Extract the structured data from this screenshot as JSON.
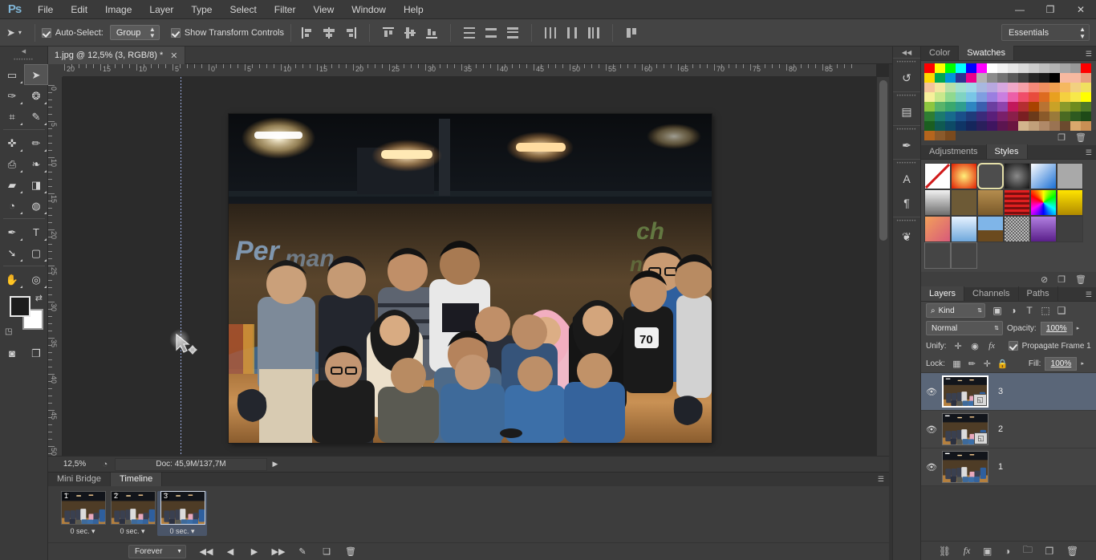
{
  "app": {
    "logo": "Ps",
    "workspace": "Essentials"
  },
  "menubar": {
    "items": [
      "File",
      "Edit",
      "Image",
      "Layer",
      "Type",
      "Select",
      "Filter",
      "View",
      "Window",
      "Help"
    ]
  },
  "window_controls": {
    "minimize": "—",
    "restore": "❐",
    "close": "✕"
  },
  "options_bar": {
    "tool_icon": "move-tool",
    "tool_glyph": "➤",
    "autoselect_label": "Auto-Select:",
    "autoselect_checked": true,
    "group_value": "Group",
    "show_transform_label": "Show Transform Controls",
    "show_transform_checked": true,
    "align_icons": [
      "align-left-edges",
      "align-horizontal-centers",
      "align-right-edges",
      "align-top-edges",
      "align-vertical-centers",
      "align-bottom-edges",
      "distribute-top-edges",
      "distribute-vertical-centers",
      "distribute-bottom-edges",
      "distribute-left-edges",
      "distribute-horizontal-centers",
      "distribute-right-edges",
      "auto-align-layers"
    ]
  },
  "toolbar": {
    "tools": [
      {
        "name": "rectangular-marquee-tool",
        "glyph": "▭",
        "active": false,
        "hasflyout": true
      },
      {
        "name": "move-tool",
        "glyph": "➤",
        "active": true,
        "hasflyout": false
      },
      {
        "name": "lasso-tool",
        "glyph": "✑",
        "active": false,
        "hasflyout": true
      },
      {
        "name": "quick-selection-tool",
        "glyph": "❂",
        "active": false,
        "hasflyout": true
      },
      {
        "name": "crop-tool",
        "glyph": "⌗",
        "active": false,
        "hasflyout": true
      },
      {
        "name": "eyedropper-tool",
        "glyph": "✎",
        "active": false,
        "hasflyout": true
      },
      {
        "name": "spot-healing-brush-tool",
        "glyph": "✜",
        "active": false,
        "hasflyout": true
      },
      {
        "name": "brush-tool",
        "glyph": "✏",
        "active": false,
        "hasflyout": true
      },
      {
        "name": "clone-stamp-tool",
        "glyph": "⎙",
        "active": false,
        "hasflyout": true
      },
      {
        "name": "history-brush-tool",
        "glyph": "❧",
        "active": false,
        "hasflyout": true
      },
      {
        "name": "eraser-tool",
        "glyph": "▰",
        "active": false,
        "hasflyout": true
      },
      {
        "name": "gradient-tool",
        "glyph": "◨",
        "active": false,
        "hasflyout": true
      },
      {
        "name": "blur-tool",
        "glyph": "◔",
        "active": false,
        "hasflyout": true
      },
      {
        "name": "dodge-tool",
        "glyph": "◍",
        "active": false,
        "hasflyout": true
      },
      {
        "name": "pen-tool",
        "glyph": "✒",
        "active": false,
        "hasflyout": true
      },
      {
        "name": "horizontal-type-tool",
        "glyph": "T",
        "active": false,
        "hasflyout": true
      },
      {
        "name": "path-selection-tool",
        "glyph": "➘",
        "active": false,
        "hasflyout": true
      },
      {
        "name": "rectangle-tool",
        "glyph": "▢",
        "active": false,
        "hasflyout": true
      },
      {
        "name": "hand-tool",
        "glyph": "✋",
        "active": false,
        "hasflyout": true
      },
      {
        "name": "zoom-tool",
        "glyph": "◎",
        "active": false,
        "hasflyout": true
      }
    ],
    "foreground_color": "#1c1c1c",
    "background_color": "#ffffff",
    "swap_icon": "swap-colors-icon",
    "reset_icon": "reset-colors-icon",
    "quickmask_icon": "quick-mask-icon",
    "screenmode_icon": "screen-mode-icon"
  },
  "document": {
    "tab_title": "1.jpg @ 12,5% (3, RGB/8) *",
    "close_label": "✕"
  },
  "rulers": {
    "horizontal_labels": [
      "20",
      "15",
      "10",
      "5",
      "0",
      "5",
      "10",
      "15",
      "20",
      "25",
      "30",
      "35",
      "40",
      "45",
      "50",
      "55",
      "60",
      "65",
      "70",
      "75",
      "80",
      "85"
    ],
    "vertical_labels": [
      "0",
      "5",
      "10",
      "15",
      "20",
      "25",
      "30",
      "35",
      "40",
      "45",
      "50"
    ],
    "unit": "cm"
  },
  "status_bar": {
    "zoom": "12,5%",
    "thumb_icon": "document-thumb-icon",
    "doc_info": "Doc: 45,9M/137,7M",
    "arrow": "▶"
  },
  "timeline": {
    "tabs": [
      {
        "label": "Mini Bridge",
        "active": false
      },
      {
        "label": "Timeline",
        "active": true
      }
    ],
    "menu_icon": "panel-menu-icon",
    "frames": [
      {
        "number": "1",
        "delay": "0 sec.",
        "selected": false
      },
      {
        "number": "2",
        "delay": "0 sec.",
        "selected": false
      },
      {
        "number": "3",
        "delay": "0 sec.",
        "selected": true
      }
    ],
    "loop": "Forever",
    "controls": [
      {
        "name": "select-first-frame-button",
        "glyph": "◀◀"
      },
      {
        "name": "select-previous-frame-button",
        "glyph": "◀"
      },
      {
        "name": "play-animation-button",
        "glyph": "▶"
      },
      {
        "name": "select-next-frame-button",
        "glyph": "▶▶"
      },
      {
        "name": "tween-frames-button",
        "glyph": "✎"
      },
      {
        "name": "duplicate-frame-button",
        "glyph": "❏"
      },
      {
        "name": "delete-frame-button",
        "glyph": "🗑"
      }
    ]
  },
  "icon_dock": {
    "collapse_glyph": "◀◀",
    "groups": [
      [
        {
          "name": "history-panel-icon",
          "glyph": "↺"
        }
      ],
      [
        {
          "name": "actions-panel-icon",
          "glyph": "▤"
        }
      ],
      [
        {
          "name": "brush-panel-icon",
          "glyph": "✒"
        }
      ],
      [
        {
          "name": "character-panel-icon",
          "glyph": "A"
        },
        {
          "name": "paragraph-panel-icon",
          "glyph": "¶"
        }
      ],
      [
        {
          "name": "clone-source-panel-icon",
          "glyph": "❦"
        }
      ]
    ]
  },
  "color_panel": {
    "tabs": [
      {
        "label": "Color",
        "active": false
      },
      {
        "label": "Swatches",
        "active": true
      }
    ],
    "menu_icon": "panel-menu-icon",
    "footer": [
      {
        "name": "new-swatch-button",
        "glyph": "❐"
      },
      {
        "name": "delete-swatch-button",
        "glyph": "🗑"
      }
    ],
    "swatch_rows": [
      [
        "#ff0000",
        "#ffff00",
        "#00ff00",
        "#00ffff",
        "#0000ff",
        "#ff00ff",
        "#ffffff",
        "#f2f2f2",
        "#e6e6e6",
        "#d9d9d9",
        "#cccccc",
        "#bfbfbf",
        "#b3b3b3",
        "#a6a6a6",
        "#999999",
        "#ff0000"
      ],
      [
        "#ffd800",
        "#00a651",
        "#0095da",
        "#2e3192",
        "#ec008c",
        "#b3b3b3",
        "#8c8c8c",
        "#737373",
        "#595959",
        "#404040",
        "#262626",
        "#1a1a1a",
        "#000000",
        "#f7b9a0",
        "#f7b9a0",
        "#e8a080"
      ],
      [
        "#f4c49b",
        "#f2e6a0",
        "#b8e0a8",
        "#a3e0cf",
        "#a0d8e8",
        "#a8b8e0",
        "#b8a8e0",
        "#d8a8e0",
        "#f0a8c8",
        "#f5a0a8",
        "#f58a7a",
        "#f09060",
        "#f0a050",
        "#f5b860",
        "#f2d080",
        "#f0e060"
      ],
      [
        "#f6f09a",
        "#c8e88c",
        "#8fd98f",
        "#7fd3c2",
        "#79c6e6",
        "#7f9ee0",
        "#9a7fe0",
        "#c97fe0",
        "#ec5fa8",
        "#f04e6a",
        "#e84c3d",
        "#dd6b20",
        "#e8a020",
        "#f4d03f",
        "#f7e84a",
        "#ffff00"
      ],
      [
        "#8dc63f",
        "#58b46a",
        "#3aa86e",
        "#2f9e8f",
        "#2e86c1",
        "#3b5fae",
        "#6b3fa0",
        "#8e44ad",
        "#c2185b",
        "#b52e31",
        "#a84300",
        "#b87333",
        "#c9a227",
        "#8a9a2b",
        "#6e8b1f",
        "#4f7a28"
      ],
      [
        "#2e7d32",
        "#1b7a6e",
        "#176a8c",
        "#1a4f8a",
        "#1f3b7a",
        "#3b2a7a",
        "#5a1f7a",
        "#7a1f6a",
        "#8a1f4a",
        "#7a1f22",
        "#6b3a1a",
        "#8a5a2a",
        "#9a7a3a",
        "#4a6a22",
        "#2e5a20",
        "#1e4a18"
      ],
      [
        "#1b5e20",
        "#0f5a52",
        "#0d4a66",
        "#0f3566",
        "#15265c",
        "#2a1f5c",
        "#3f1560",
        "#5c1550",
        "#6a1540",
        "#d2b48c",
        "#c1a07a",
        "#b08968",
        "#9a7352",
        "#6b4a2e",
        "#d9a86c",
        "#c98f54"
      ],
      [
        "#b5651d",
        "#8b5a2b",
        "#7a4a1e"
      ]
    ]
  },
  "styles_panel": {
    "tabs": [
      {
        "label": "Adjustments",
        "active": false
      },
      {
        "label": "Styles",
        "active": true
      }
    ],
    "menu_icon": "panel-menu-icon",
    "footer": [
      {
        "name": "clear-style-button",
        "glyph": "⊘"
      },
      {
        "name": "new-style-button",
        "glyph": "❐"
      },
      {
        "name": "delete-style-button",
        "glyph": "🗑"
      }
    ],
    "styles": [
      {
        "name": "style-none",
        "kind": "none"
      },
      {
        "name": "style-red-glow",
        "kind": "radial",
        "c1": "#ffef7a",
        "c2": "#e01b00"
      },
      {
        "name": "style-selected-frame",
        "kind": "frame",
        "c1": "#4d4d4d",
        "c2": "#e4dfa8",
        "selected": true
      },
      {
        "name": "style-dark-metal",
        "kind": "radial",
        "c1": "#8a8a8a",
        "c2": "#141414"
      },
      {
        "name": "style-blue-glass",
        "kind": "diag",
        "c1": "#ffffff",
        "c2": "#1a6fd4"
      },
      {
        "name": "style-gray-flat",
        "kind": "flat",
        "c1": "#a9a9a9",
        "c2": "#a9a9a9"
      },
      {
        "name": "style-chrome",
        "kind": "vert",
        "c1": "#f2f2f2",
        "c2": "#6e6e6e"
      },
      {
        "name": "style-soft-brown",
        "kind": "flat",
        "c1": "#6d5a36",
        "c2": "#6d5a36"
      },
      {
        "name": "style-tan",
        "kind": "vert",
        "c1": "#b58d4e",
        "c2": "#7a5a2a"
      },
      {
        "name": "style-red-stripes",
        "kind": "stripes",
        "c1": "#e02020",
        "c2": "#7a0e0e"
      },
      {
        "name": "style-rainbow",
        "kind": "rainbow",
        "c1": "#00ff00",
        "c2": "#ff00aa"
      },
      {
        "name": "style-yellow-bevel",
        "kind": "vert",
        "c1": "#ffe400",
        "c2": "#b08a00"
      },
      {
        "name": "style-sunset",
        "kind": "diag",
        "c1": "#f2a05a",
        "c2": "#d85a7a"
      },
      {
        "name": "style-sky",
        "kind": "vert",
        "c1": "#e6f2ff",
        "c2": "#6fa8dc"
      },
      {
        "name": "style-horizon",
        "kind": "horizon",
        "c1": "#7fb5e8",
        "c2": "#6b4a1e"
      },
      {
        "name": "style-noise",
        "kind": "noise",
        "c1": "#cccccc",
        "c2": "#555555"
      },
      {
        "name": "style-purple-gloss",
        "kind": "vert",
        "c1": "#b07fe0",
        "c2": "#5a1f8a"
      },
      {
        "name": "style-dark-plate",
        "kind": "flat",
        "c1": "#3f3f3f",
        "c2": "#3f3f3f"
      },
      {
        "name": "style-empty-1",
        "kind": "outline"
      },
      {
        "name": "style-empty-2",
        "kind": "outline"
      }
    ]
  },
  "layers_panel": {
    "tabs": [
      {
        "label": "Layers",
        "active": true
      },
      {
        "label": "Channels",
        "active": false
      },
      {
        "label": "Paths",
        "active": false
      }
    ],
    "menu_icon": "panel-menu-icon",
    "filter": {
      "search_icon": "search-icon",
      "kind_value": "Kind",
      "type_icons": [
        {
          "name": "filter-pixel-layers-icon",
          "glyph": "▣"
        },
        {
          "name": "filter-adjustment-layers-icon",
          "glyph": "◑"
        },
        {
          "name": "filter-type-layers-icon",
          "glyph": "T"
        },
        {
          "name": "filter-shape-layers-icon",
          "glyph": "⬚"
        },
        {
          "name": "filter-smart-objects-icon",
          "glyph": "❑"
        }
      ]
    },
    "blend_mode": "Normal",
    "opacity_label": "Opacity:",
    "opacity_value": "100%",
    "unify_label": "Unify:",
    "unify_icons": [
      {
        "name": "unify-layer-position-icon",
        "glyph": "✛"
      },
      {
        "name": "unify-layer-visibility-icon",
        "glyph": "◉"
      },
      {
        "name": "unify-layer-style-icon",
        "glyph": "fx"
      }
    ],
    "propagate_label": "Propagate Frame 1",
    "propagate_checked": true,
    "lock_label": "Lock:",
    "lock_icons": [
      {
        "name": "lock-transparent-pixels-icon",
        "glyph": "▦"
      },
      {
        "name": "lock-image-pixels-icon",
        "glyph": "✏"
      },
      {
        "name": "lock-position-icon",
        "glyph": "✛"
      },
      {
        "name": "lock-all-icon",
        "glyph": "🔒"
      }
    ],
    "fill_label": "Fill:",
    "fill_value": "100%",
    "layers": [
      {
        "name": "3",
        "visible": true,
        "selected": true,
        "badge": "smart-object-badge"
      },
      {
        "name": "2",
        "visible": true,
        "selected": false,
        "badge": "smart-object-badge"
      },
      {
        "name": "1",
        "visible": true,
        "selected": false,
        "badge": ""
      }
    ],
    "footer": [
      {
        "name": "link-layers-button",
        "glyph": "⛓"
      },
      {
        "name": "add-layer-style-button",
        "glyph": "fx"
      },
      {
        "name": "add-layer-mask-button",
        "glyph": "▣"
      },
      {
        "name": "new-adjustment-layer-button",
        "glyph": "◑"
      },
      {
        "name": "new-group-button",
        "glyph": "🗀"
      },
      {
        "name": "new-layer-button",
        "glyph": "❐"
      },
      {
        "name": "delete-layer-button",
        "glyph": "🗑"
      }
    ]
  },
  "colors": {
    "app_bg": "#333333",
    "panel_bg": "#3d3d3d",
    "panel_light": "#454545",
    "accent_selection": "#5a6678",
    "text": "#d4d4d4"
  }
}
